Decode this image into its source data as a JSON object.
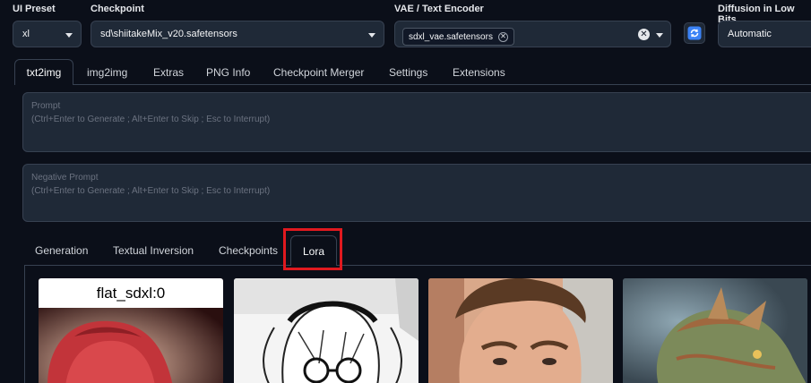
{
  "top": {
    "ui_preset": {
      "label": "UI Preset",
      "value": "xl"
    },
    "checkpoint": {
      "label": "Checkpoint",
      "value": "sd\\shiitakeMix_v20.safetensors"
    },
    "vae": {
      "label": "VAE / Text Encoder",
      "chip": "sdxl_vae.safetensors"
    },
    "diffusion": {
      "label": "Diffusion in Low Bits",
      "value": "Automatic"
    }
  },
  "main_tabs": [
    "txt2img",
    "img2img",
    "Extras",
    "PNG Info",
    "Checkpoint Merger",
    "Settings",
    "Extensions"
  ],
  "prompt": {
    "title": "Prompt",
    "placeholder": "(Ctrl+Enter to Generate ; Alt+Enter to Skip ; Esc to Interrupt)"
  },
  "negative_prompt": {
    "title": "Negative Prompt",
    "placeholder": "(Ctrl+Enter to Generate ; Alt+Enter to Skip ; Esc to Interrupt)"
  },
  "sub_tabs": [
    "Generation",
    "Textual Inversion",
    "Checkpoints",
    "Lora"
  ],
  "highlight_color": "#e0191f",
  "cards": [
    {
      "caption": "flat_sdxl:0",
      "icon": "anime-red-hair-thumbnail"
    },
    {
      "icon": "manga-glasses-girl-thumbnail"
    },
    {
      "icon": "man-portrait-thumbnail"
    },
    {
      "icon": "dragon-thumbnail"
    }
  ]
}
